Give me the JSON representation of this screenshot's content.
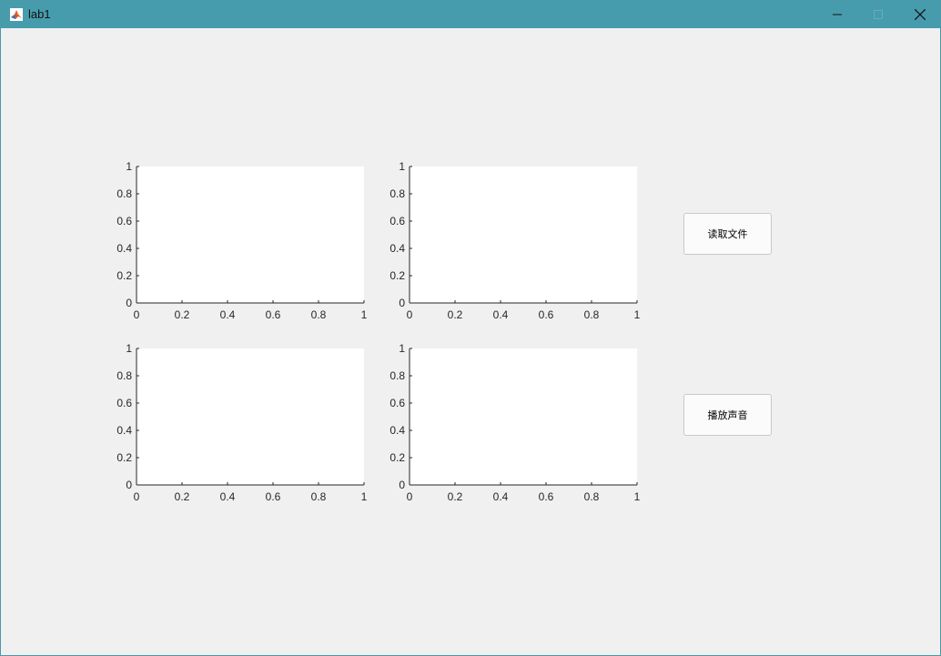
{
  "window": {
    "title": "lab1"
  },
  "controls": {
    "minimize": "minimize-icon",
    "maximize": "maximize-icon",
    "close": "close-icon"
  },
  "buttons": {
    "read_file": "读取文件",
    "play_sound": "播放声音"
  },
  "chart_data": [
    {
      "type": "line",
      "series": [],
      "xlim": [
        0,
        1
      ],
      "ylim": [
        0,
        1
      ],
      "xticks": [
        "0",
        "0.2",
        "0.4",
        "0.6",
        "0.8",
        "1"
      ],
      "yticks": [
        "0",
        "0.2",
        "0.4",
        "0.6",
        "0.8",
        "1"
      ],
      "grid": false
    },
    {
      "type": "line",
      "series": [],
      "xlim": [
        0,
        1
      ],
      "ylim": [
        0,
        1
      ],
      "xticks": [
        "0",
        "0.2",
        "0.4",
        "0.6",
        "0.8",
        "1"
      ],
      "yticks": [
        "0",
        "0.2",
        "0.4",
        "0.6",
        "0.8",
        "1"
      ],
      "grid": false
    },
    {
      "type": "line",
      "series": [],
      "xlim": [
        0,
        1
      ],
      "ylim": [
        0,
        1
      ],
      "xticks": [
        "0",
        "0.2",
        "0.4",
        "0.6",
        "0.8",
        "1"
      ],
      "yticks": [
        "0",
        "0.2",
        "0.4",
        "0.6",
        "0.8",
        "1"
      ],
      "grid": false
    },
    {
      "type": "line",
      "series": [],
      "xlim": [
        0,
        1
      ],
      "ylim": [
        0,
        1
      ],
      "xticks": [
        "0",
        "0.2",
        "0.4",
        "0.6",
        "0.8",
        "1"
      ],
      "yticks": [
        "0",
        "0.2",
        "0.4",
        "0.6",
        "0.8",
        "1"
      ],
      "grid": false
    }
  ]
}
